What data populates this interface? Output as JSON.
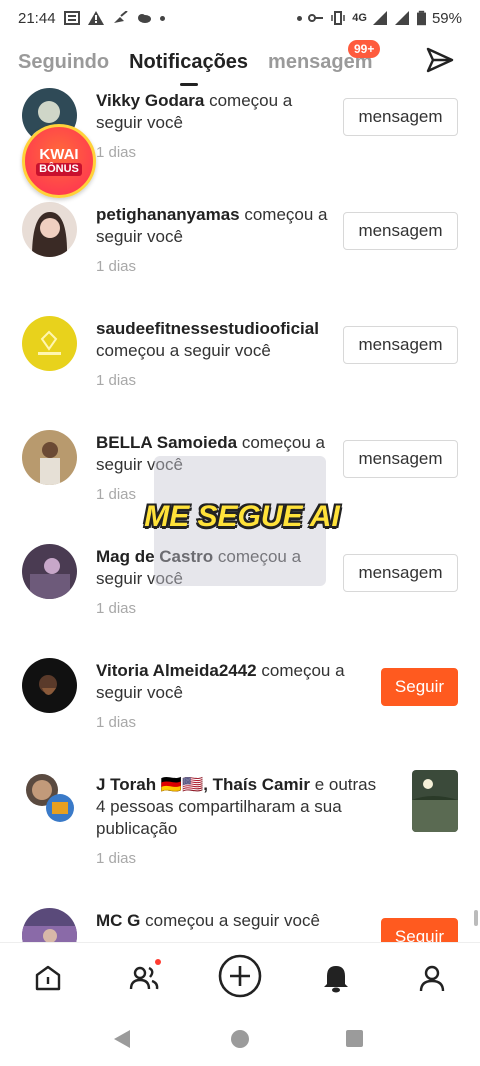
{
  "status": {
    "time": "21:44",
    "network": "4G",
    "battery": "59%"
  },
  "tabs": {
    "following": "Seguindo",
    "notifications": "Notificações",
    "messages": "mensagem",
    "messages_badge": "99+"
  },
  "notifications": [
    {
      "name": "Vikky Godara",
      "action": "começou a seguir você",
      "time": "1 dias",
      "button": "mensagem",
      "avatar_color": "#2f4a57"
    },
    {
      "name": "petighananyamas",
      "action": "começou a seguir você",
      "time": "1 dias",
      "button": "mensagem",
      "avatar_color": "#c9b6ad"
    },
    {
      "name": "saudeefitnessestudiooficial",
      "action": "começou a seguir você",
      "time": "1 dias",
      "button": "mensagem",
      "avatar_color": "#e8d21c"
    },
    {
      "name": "BELLA Samoieda",
      "action": "começou a seguir você",
      "time": "1 dias",
      "button": "mensagem",
      "avatar_color": "#8b6b4a"
    },
    {
      "name": "Mag de Castro",
      "action": "começou a seguir você",
      "time": "1 dias",
      "button": "mensagem",
      "avatar_color": "#4a3b52"
    },
    {
      "name": "Vitoria Almeida2442",
      "action": "começou a seguir você",
      "time": "1 dias",
      "button": "Seguir",
      "avatar_color": "#1a1a1a"
    },
    {
      "name": "J Torah 🇩🇪🇺🇸, Thaís Camir",
      "action": "e outras 4 pessoas compartilharam a sua publicação",
      "time": "1 dias",
      "avatar_color": "#3a7ac8"
    },
    {
      "name": "MC G",
      "action": "começou a seguir você",
      "button": "Seguir",
      "avatar_color": "#5a4a7a"
    }
  ],
  "overlays": {
    "kwai_line1": "KWAI",
    "kwai_line2": "BÔNUS",
    "caption": "ME SEGUE AI"
  },
  "colors": {
    "accent": "#ff5a1f",
    "badge": "#fe5b3d",
    "caption": "#ffe23a"
  },
  "icons": {
    "send": "send-icon",
    "home": "home-icon",
    "friends": "friends-icon",
    "create": "plus-circle-icon",
    "notifications": "bell-icon",
    "profile": "profile-icon"
  }
}
